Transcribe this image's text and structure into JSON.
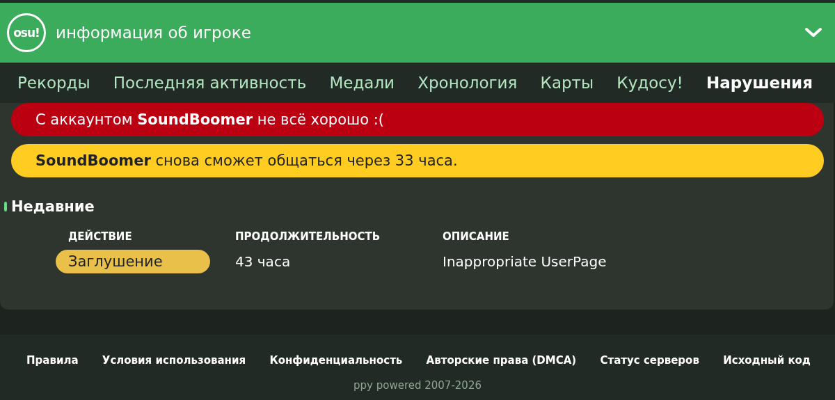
{
  "header": {
    "logo": "osu!",
    "title": "информация об игроке"
  },
  "tabs": [
    {
      "label": "Рекорды",
      "selected": false
    },
    {
      "label": "Последняя активность",
      "selected": false
    },
    {
      "label": "Медали",
      "selected": false
    },
    {
      "label": "Хронология",
      "selected": false
    },
    {
      "label": "Карты",
      "selected": false
    },
    {
      "label": "Кудосу!",
      "selected": false
    },
    {
      "label": "Нарушения",
      "selected": true
    }
  ],
  "alerts": [
    {
      "kind": "danger",
      "text": "С аккаунтом **SoundBoomer** не всё хорошо :("
    },
    {
      "kind": "warning",
      "text": "**SoundBoomer** снова сможет общаться через 33 часа."
    }
  ],
  "recent": {
    "title": "Недавние",
    "columns": [
      "ДЕЙСТВИЕ",
      "ПРОДОЛЖИТЕЛЬНОСТЬ",
      "ОПИСАНИЕ"
    ],
    "rows": [
      {
        "action": "Заглушение",
        "kind": "silence",
        "duration": "43 часа",
        "description": "Inappropriate UserPage"
      }
    ]
  },
  "footer": {
    "links": [
      "Правила",
      "Условия использования",
      "Конфиденциальность",
      "Авторские права (DMCA)",
      "Статус серверов",
      "Исходный код"
    ],
    "copyright": "ppy powered 2007-2026"
  }
}
